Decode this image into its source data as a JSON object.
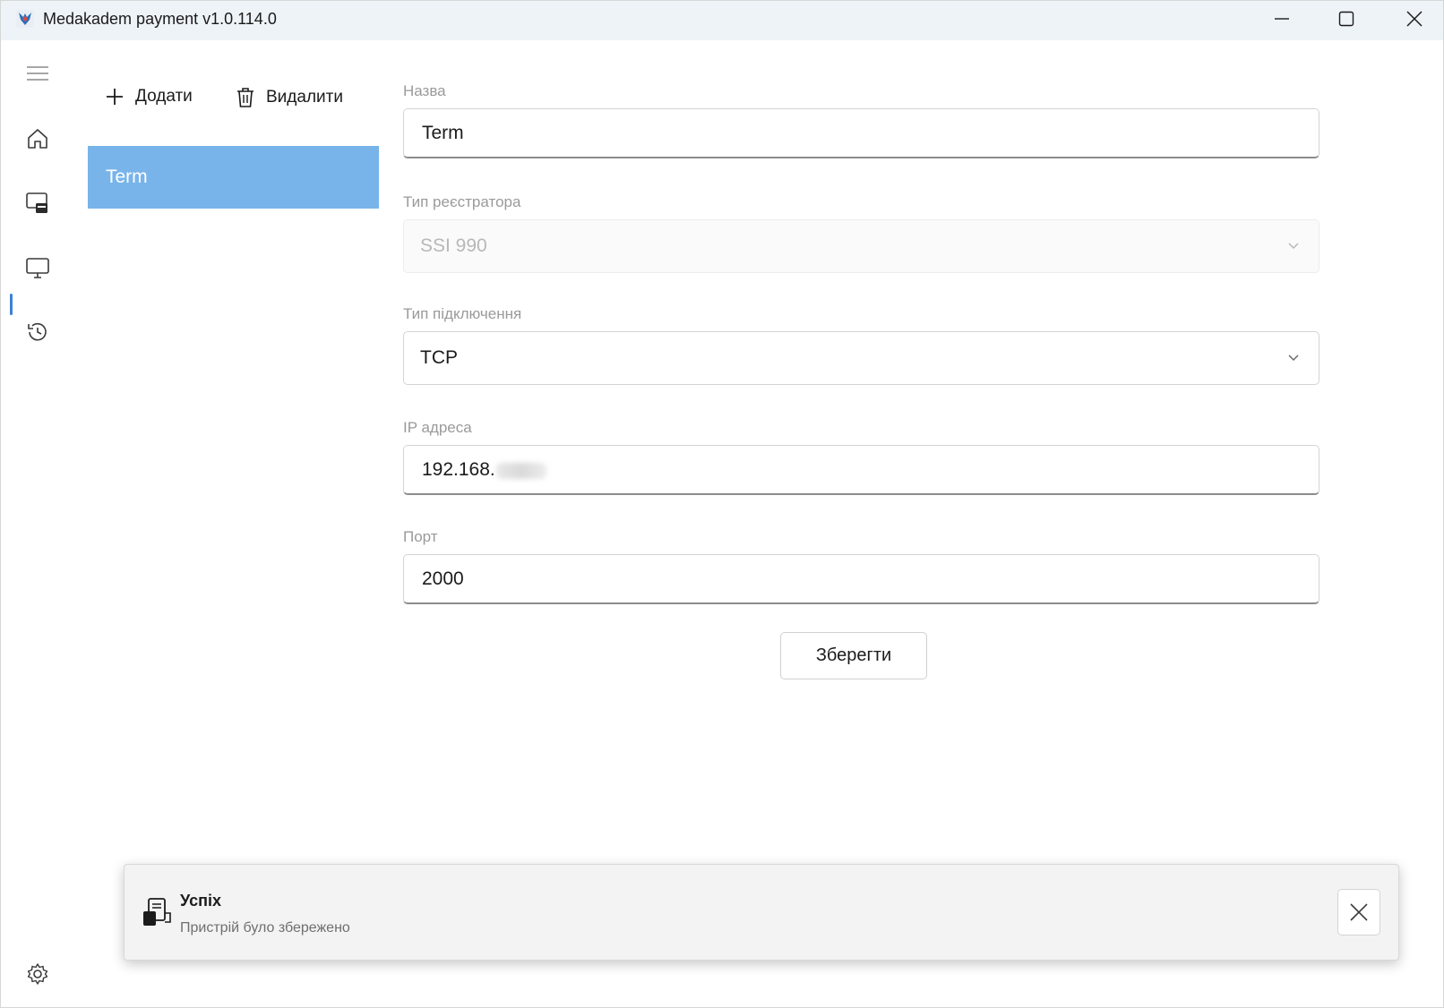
{
  "window": {
    "title": "Medakadem payment v1.0.114.0",
    "controls": [
      "minimize",
      "maximize",
      "close"
    ]
  },
  "nav": {
    "items": [
      {
        "icon": "menu-icon"
      },
      {
        "icon": "home-icon"
      },
      {
        "icon": "cash-register-icon"
      },
      {
        "icon": "monitor-icon",
        "selected": true
      },
      {
        "icon": "history-icon"
      },
      {
        "icon": "settings-icon"
      }
    ],
    "accent_color": "#3b82d6"
  },
  "toolbar": {
    "add_label": "Додати",
    "delete_label": "Видалити"
  },
  "devices": {
    "items": [
      {
        "label": "Term",
        "selected": true
      }
    ],
    "selected_color": "#78b4ea"
  },
  "form": {
    "name_label": "Назва",
    "name_value": "Term",
    "registrar_type_label": "Тип реєстратора",
    "registrar_type_value": "SSI 990",
    "connection_type_label": "Тип підключення",
    "connection_type_value": "TCP",
    "ip_label": "IP адреса",
    "ip_value": "192.168.",
    "port_label": "Порт",
    "port_value": "2000",
    "save_label": "Зберегти"
  },
  "toast": {
    "title": "Успіх",
    "message": "Пристрій було збережено",
    "icon": "device-saved-icon"
  }
}
